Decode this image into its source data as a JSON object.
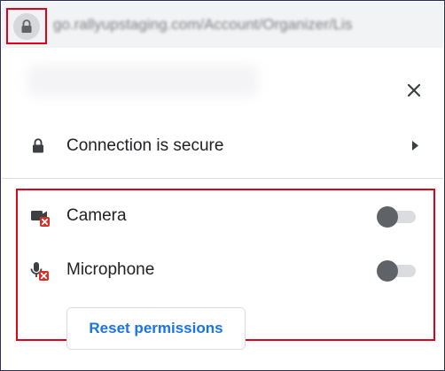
{
  "address_bar": {
    "url": "go.rallyupstaging.com/Account/Organizer/Lis",
    "lock_icon": "lock-icon"
  },
  "popup": {
    "close_icon": "close-icon",
    "connection": {
      "label": "Connection is secure",
      "icon": "lock-icon",
      "arrow_icon": "caret-right-icon"
    },
    "permissions": [
      {
        "label": "Camera",
        "icon": "camera-blocked-icon",
        "enabled": false
      },
      {
        "label": "Microphone",
        "icon": "microphone-blocked-icon",
        "enabled": false
      }
    ],
    "reset_button_label": "Reset permissions"
  },
  "colors": {
    "highlight": "#e0001b",
    "accent": "#1a73e8",
    "blocked_badge": "#d93025"
  }
}
